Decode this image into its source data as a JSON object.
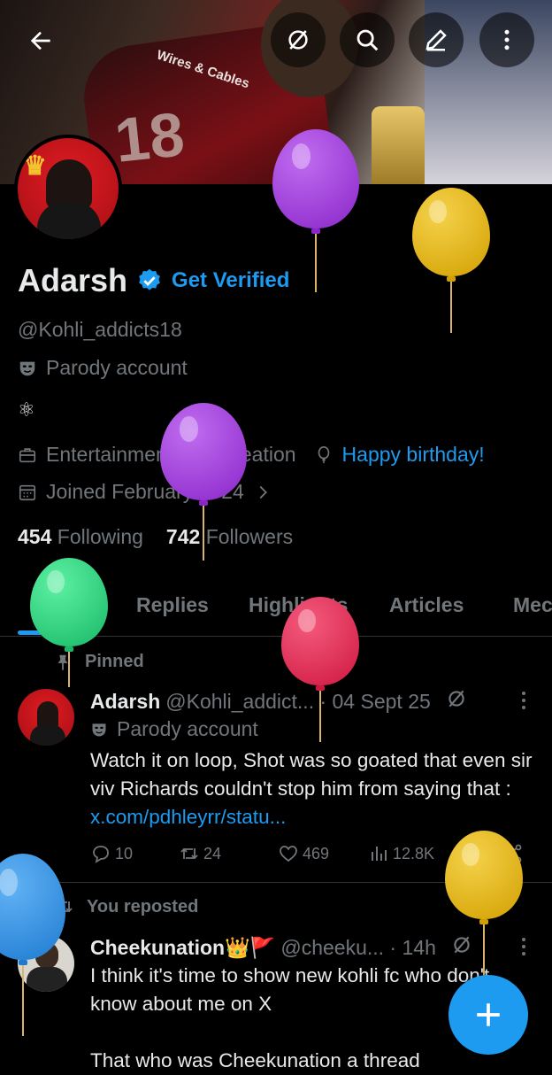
{
  "profile": {
    "name": "Adarsh",
    "get_verified": "Get Verified",
    "handle": "@Kohli_addicts18",
    "parody_label": "Parody account",
    "bio": "⚛",
    "category": "Entertainment & Recreation",
    "birthday": "Happy birthday!",
    "joined": "Joined February 2024",
    "following_count": "454",
    "following_label": "Following",
    "followers_count": "742",
    "followers_label": "Followers"
  },
  "banner": {
    "jersey_text": "Wires & Cables",
    "jersey_number": "18"
  },
  "top_bar_icons": [
    "back-arrow-icon",
    "grok-icon",
    "search-icon",
    "compose-icon",
    "more-vertical-icon"
  ],
  "tabs": [
    {
      "label": "Posts",
      "active": true
    },
    {
      "label": "Replies",
      "active": false
    },
    {
      "label": "Highlights",
      "active": false
    },
    {
      "label": "Articles",
      "active": false
    },
    {
      "label": "Mec",
      "active": false
    }
  ],
  "posts": [
    {
      "context": "Pinned",
      "author": "Adarsh",
      "handle_time": "@Kohli_addict... · 04 Sept 25",
      "parody_label": "Parody account",
      "text": "Watch it on loop, Shot was so goated that even sir viv Richards couldn't stop him from saying that : ",
      "link": "x.com/pdhleyrr/statu...",
      "replies": "10",
      "reposts": "24",
      "likes": "469",
      "views": "12.8K"
    },
    {
      "context": "You reposted",
      "author": "Cheekunation👑🚩",
      "handle_time": "@cheeku... · 14h",
      "text_line1": "I think it's time to show new kohli fc who don't know about me on X",
      "text_line2": "That who was Cheekunation a thread"
    }
  ],
  "colors": {
    "accent": "#1d9bf0",
    "background": "#000000",
    "text_primary": "#e7e9ea",
    "text_secondary": "#71767b",
    "balloon_purple": "#9b30d9",
    "balloon_yellow": "#e6b400",
    "balloon_green": "#1fd27a",
    "balloon_red": "#e8264f",
    "balloon_blue": "#2b8fe0"
  }
}
